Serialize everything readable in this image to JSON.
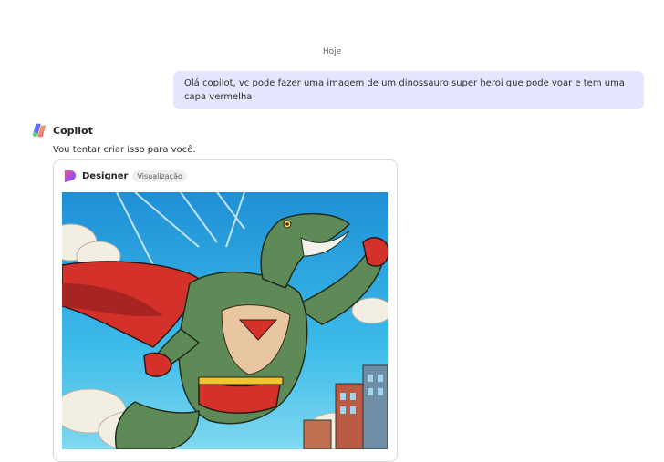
{
  "chat": {
    "date_separator": "Hoje",
    "user_message": "Olá copilot, vc pode fazer uma imagem de um dinossauro super heroi que pode voar e tem uma capa vermelha",
    "assistant": {
      "name": "Copilot",
      "reply": "Vou tentar criar isso para você."
    },
    "designer_card": {
      "name": "Designer",
      "badge": "Visualização",
      "image_icon": "superhero-dinosaur-illustration"
    }
  },
  "colors": {
    "user_bubble": "#e3e6fd",
    "sky": "#39b4e8",
    "cape_red": "#d4312b",
    "dino_green": "#5e8a57"
  }
}
